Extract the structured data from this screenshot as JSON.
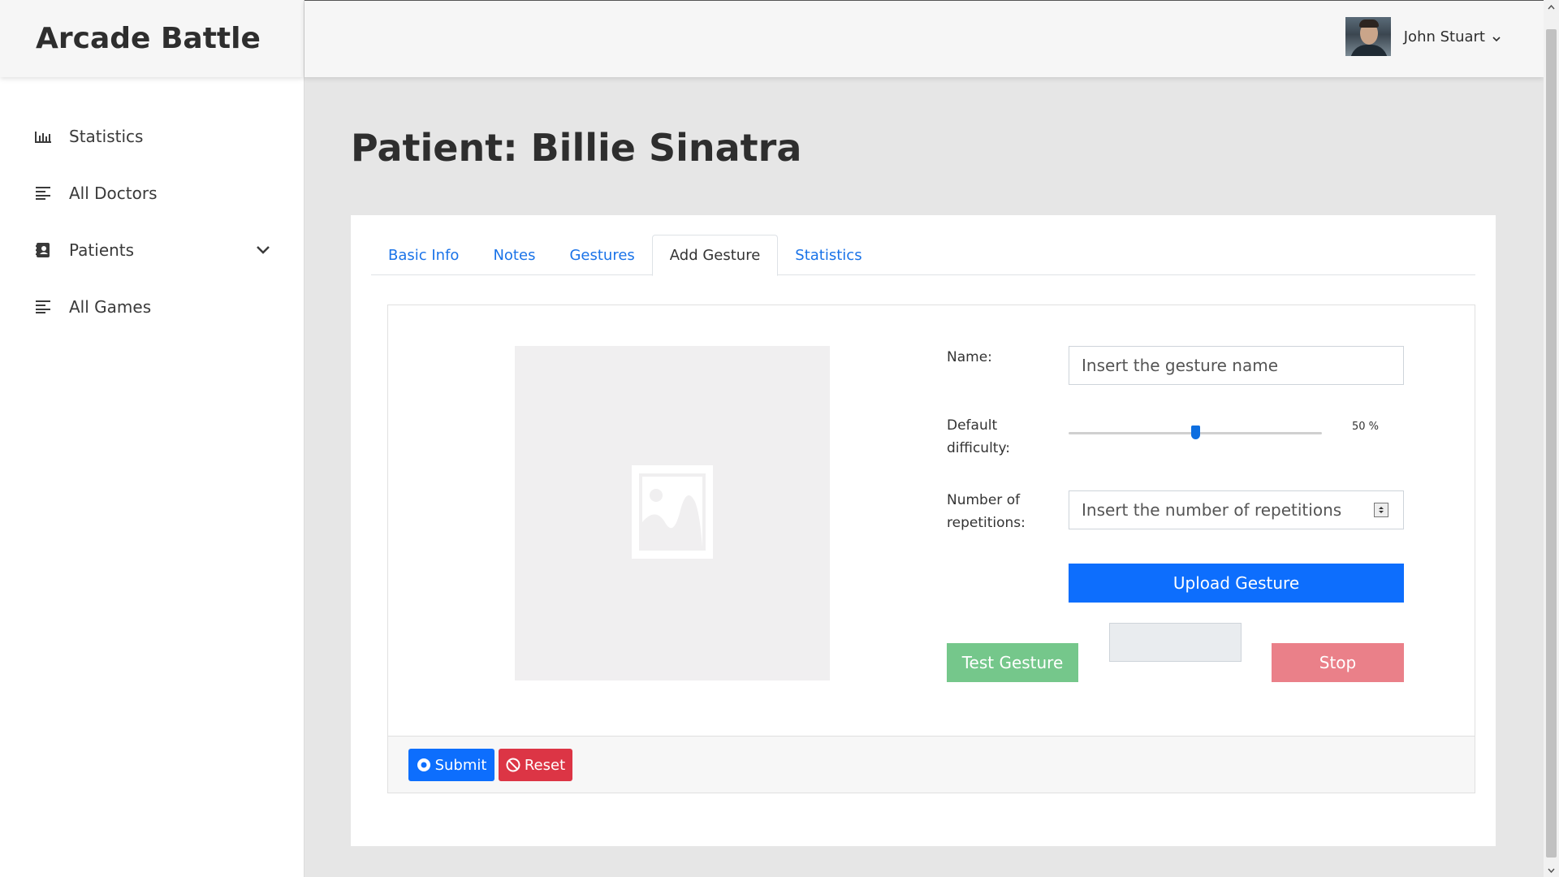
{
  "brand": {
    "title": "Arcade Battle"
  },
  "sidebar": {
    "items": [
      {
        "label": "Statistics",
        "icon": "bar-chart-icon"
      },
      {
        "label": "All Doctors",
        "icon": "list-icon"
      },
      {
        "label": "Patients",
        "icon": "contact-book-icon",
        "expandable": true
      },
      {
        "label": "All Games",
        "icon": "list-icon"
      }
    ]
  },
  "header": {
    "user_name": "John Stuart"
  },
  "page": {
    "title": "Patient: Billie Sinatra"
  },
  "tabs": [
    {
      "label": "Basic Info",
      "active": false
    },
    {
      "label": "Notes",
      "active": false
    },
    {
      "label": "Gestures",
      "active": false
    },
    {
      "label": "Add Gesture",
      "active": true
    },
    {
      "label": "Statistics",
      "active": false
    }
  ],
  "form": {
    "name_label": "Name:",
    "name_placeholder": "Insert the gesture name",
    "difficulty_label": "Default difficulty:",
    "difficulty_value": "50 %",
    "difficulty_fraction": 0.5,
    "repetitions_label": "Number of repetitions:",
    "repetitions_placeholder": "Insert the number of repetitions",
    "upload_label": "Upload Gesture",
    "test_label": "Test Gesture",
    "stop_label": "Stop"
  },
  "footer": {
    "submit_label": "Submit",
    "reset_label": "Reset"
  },
  "colors": {
    "primary": "#0d6efd",
    "success_light": "#75c78b",
    "danger_light": "#ea8089",
    "danger": "#dc3545",
    "link": "#1a73e8"
  }
}
